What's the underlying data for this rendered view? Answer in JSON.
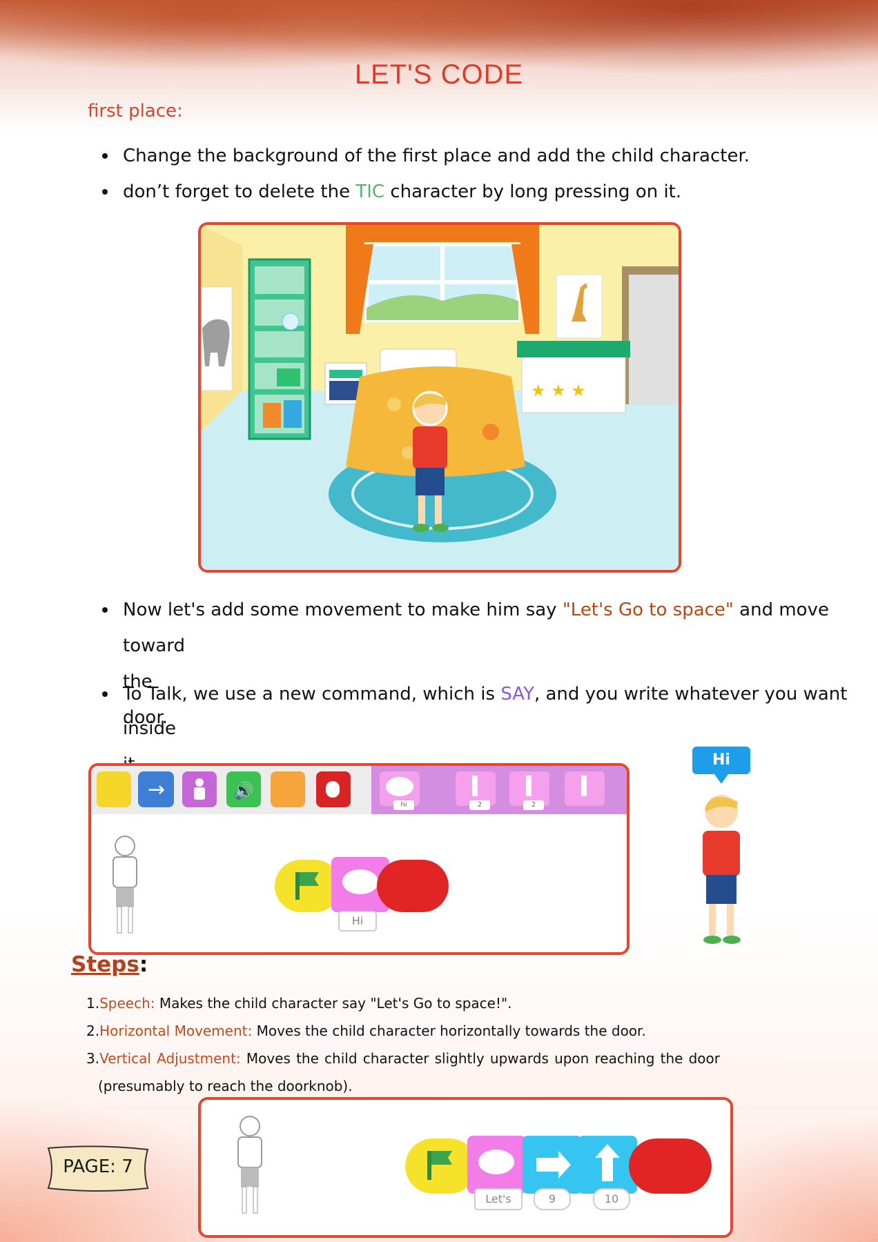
{
  "title": "LET'S CODE",
  "section_label": "first place:",
  "bullets_top": [
    {
      "pre": "Change the background of the first place and add the child character.",
      "highlight": "",
      "post": ""
    },
    {
      "pre": "don’t forget to delete the ",
      "highlight": "TIC",
      "post": " character by long pressing on it."
    }
  ],
  "bullet3": {
    "pre": "Now let's add some movement to make him say ",
    "highlight": "\"Let's Go to space\"",
    "post": " and move",
    "line2": "toward the door."
  },
  "bullet4": {
    "pre": "To Talk, we use a new command, which is ",
    "highlight": "SAY",
    "post": ", and you write whatever you want",
    "line2": "inside it."
  },
  "editor": {
    "palette_labels": [
      "hi",
      "2",
      "2"
    ],
    "say_block_value": "Hi",
    "speech_bubble": "Hi"
  },
  "steps": {
    "title": "Steps",
    "colon": ":",
    "items": [
      {
        "num": "1.",
        "label": "Speech:",
        "text": " Makes the child character say \"Let's Go to space!\"."
      },
      {
        "num": "2.",
        "label": "Horizontal Movement:",
        "text": " Moves the child character horizontally towards the door."
      },
      {
        "num": "3.",
        "label": "Vertical Adjustment:",
        "text": " Moves the child character slightly upwards upon reaching the door",
        "line2": "(presumably to reach the doorknob)."
      }
    ]
  },
  "script2": {
    "say_value": "Let's",
    "right_value": "9",
    "up_value": "10"
  },
  "page": "PAGE: 7",
  "colors": {
    "accent": "#e8452f",
    "title": "#e03b2a",
    "green_text": "#57b36c",
    "brown_text": "#b8460f",
    "purple_text": "#8a55e6"
  }
}
